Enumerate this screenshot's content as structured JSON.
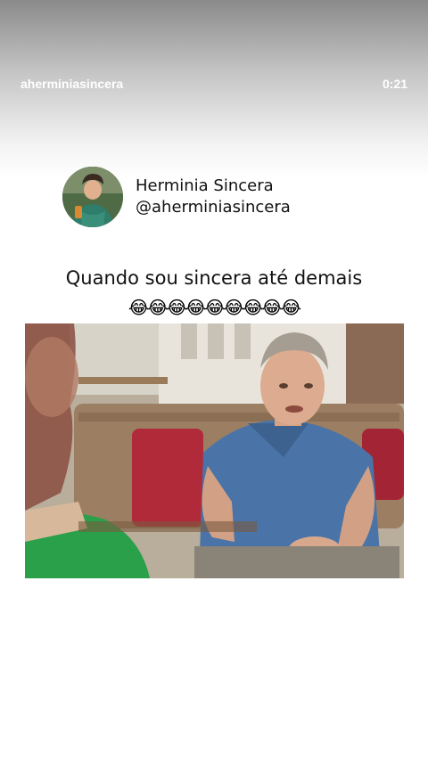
{
  "story": {
    "username": "aherminiasincera",
    "time": "0:21"
  },
  "post": {
    "display_name": "Herminia Sincera",
    "handle": "@aherminiasincera",
    "caption": "Quando sou sincera até demais",
    "emojis": "😂😂😂😂😂😂😂😂😂"
  },
  "icons": {
    "emoji": "face-with-tears-of-joy"
  }
}
